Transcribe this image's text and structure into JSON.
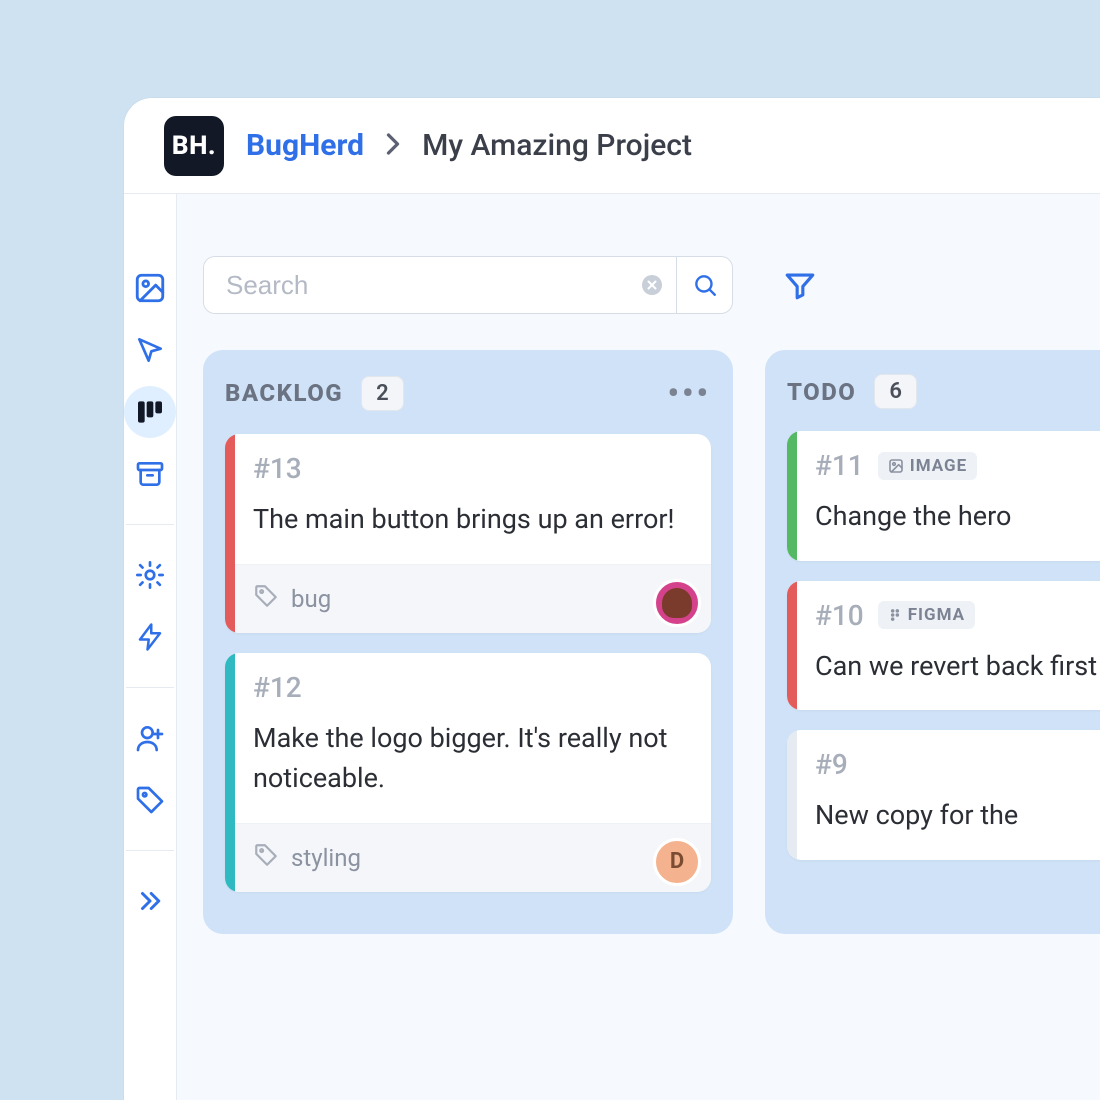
{
  "logo_text": "BH.",
  "breadcrumb": {
    "root": "BugHerd",
    "current": "My Amazing Project"
  },
  "search": {
    "placeholder": "Search"
  },
  "columns": [
    {
      "title": "BACKLOG",
      "count": "2",
      "show_more": true,
      "cards": [
        {
          "id": "#13",
          "text": "The main button brings up an error!",
          "stripe": "red",
          "badge": null,
          "tag": "bug",
          "avatar_type": "img",
          "avatar_letter": ""
        },
        {
          "id": "#12",
          "text": "Make the logo bigger. It's really not noticeable.",
          "stripe": "teal",
          "badge": null,
          "tag": "styling",
          "avatar_type": "letter",
          "avatar_letter": "D"
        }
      ]
    },
    {
      "title": "TODO",
      "count": "6",
      "show_more": false,
      "cards": [
        {
          "id": "#11",
          "text": "Change the hero",
          "stripe": "green",
          "badge": "IMAGE",
          "tag": null,
          "avatar_type": null,
          "avatar_letter": ""
        },
        {
          "id": "#10",
          "text": "Can we revert back first concept?",
          "stripe": "red",
          "badge": "FIGMA",
          "tag": null,
          "avatar_type": null,
          "avatar_letter": ""
        },
        {
          "id": "#9",
          "text": "New copy for the",
          "stripe": "none",
          "badge": null,
          "tag": null,
          "avatar_type": null,
          "avatar_letter": ""
        }
      ]
    }
  ]
}
